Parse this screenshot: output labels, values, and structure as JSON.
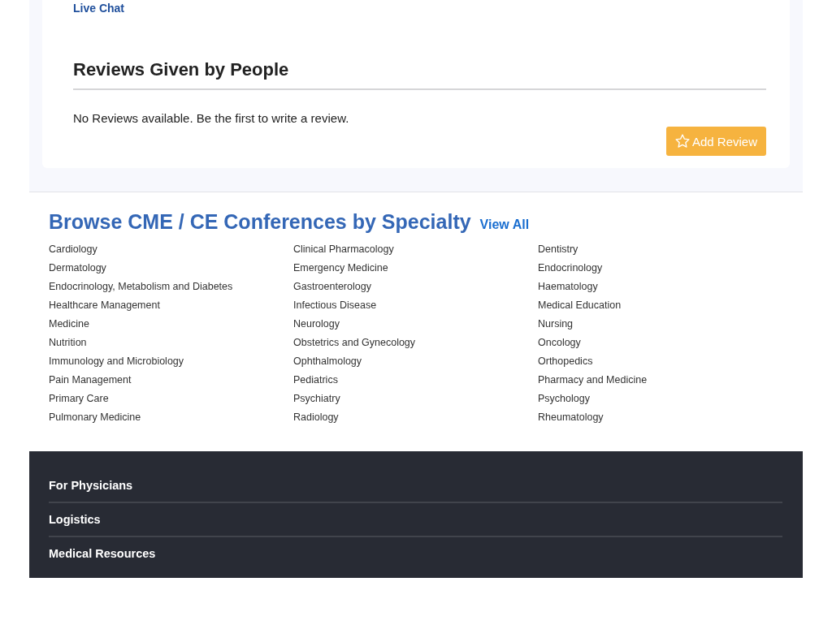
{
  "contact_card": {
    "live_chat_link": "Live Chat"
  },
  "reviews": {
    "title": "Reviews Given by People",
    "empty_message": "No Reviews available. Be the first to write a review.",
    "add_button": "Add Review"
  },
  "browse": {
    "title": "Browse CME / CE Conferences by Specialty",
    "view_all": "View All",
    "specialties": [
      "Cardiology",
      "Clinical Pharmacology",
      "Dentistry",
      "Dermatology",
      "Emergency Medicine",
      "Endocrinology",
      "Endocrinology, Metabolism and Diabetes",
      "Gastroenterology",
      "Haematology",
      "Healthcare Management",
      "Infectious Disease",
      "Medical Education",
      "Medicine",
      "Neurology",
      "Nursing",
      "Nutrition",
      "Obstetrics and Gynecology",
      "Oncology",
      "Immunology and Microbiology",
      "Ophthalmology",
      "Orthopedics",
      "Pain Management",
      "Pediatrics",
      "Pharmacy and Medicine",
      "Primary Care",
      "Psychiatry",
      "Psychology",
      "Pulmonary Medicine",
      "Radiology",
      "Rheumatology"
    ]
  },
  "footer": {
    "sections": [
      "For Physicians",
      "Logistics",
      "Medical Resources"
    ]
  }
}
